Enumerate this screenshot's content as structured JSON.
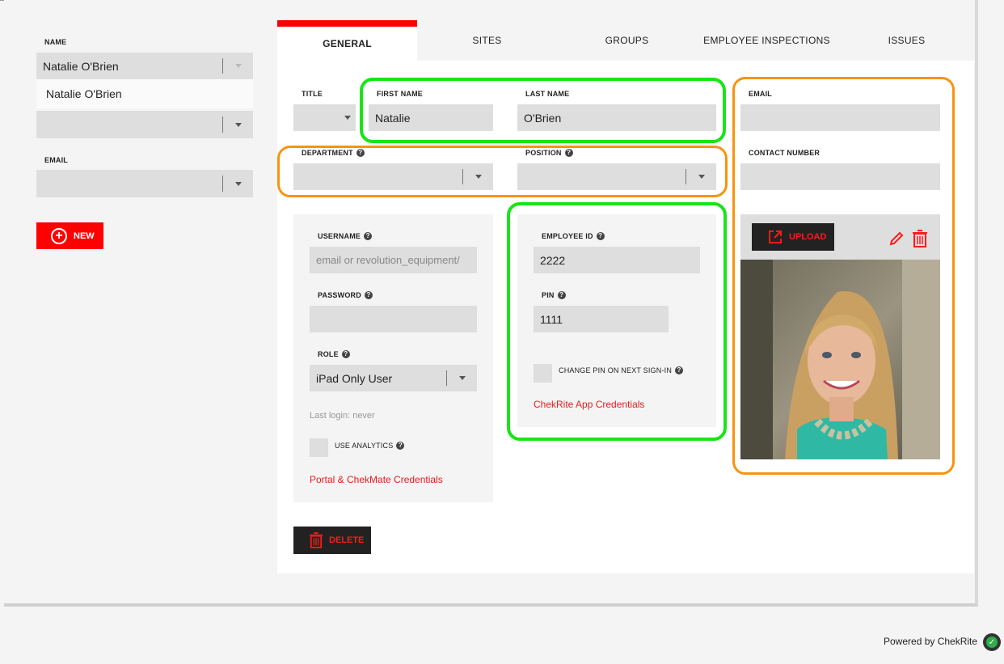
{
  "sidebar": {
    "name_label": "NAME",
    "name_value": "Natalie O'Brien",
    "name_option": "Natalie O'Brien",
    "second_select_value": "",
    "email_label": "EMAIL",
    "email_value": "",
    "new_button": "NEW"
  },
  "tabs": [
    "GENERAL",
    "SITES",
    "GROUPS",
    "EMPLOYEE INSPECTIONS",
    "ISSUES"
  ],
  "form": {
    "title_label": "TITLE",
    "title_value": "",
    "first_name_label": "FIRST NAME",
    "first_name_value": "Natalie",
    "last_name_label": "LAST NAME",
    "last_name_value": "O'Brien",
    "department_label": "DEPARTMENT",
    "department_value": "",
    "position_label": "POSITION",
    "position_value": "",
    "email_label": "EMAIL",
    "email_value": "",
    "contact_label": "CONTACT NUMBER",
    "contact_value": ""
  },
  "portal": {
    "username_label": "USERNAME",
    "username_placeholder": "email or revolution_equipment/",
    "password_label": "PASSWORD",
    "password_value": "",
    "role_label": "ROLE",
    "role_value": "iPad Only User",
    "last_login": "Last login: never",
    "analytics_label": "USE ANALYTICS",
    "credentials_link": "Portal & ChekMate Credentials",
    "delete_button": "DELETE"
  },
  "app": {
    "employee_id_label": "EMPLOYEE ID",
    "employee_id_value": "2222",
    "pin_label": "PIN",
    "pin_value": "1111",
    "change_pin_label": "CHANGE PIN ON NEXT SIGN-IN",
    "credentials_link": "ChekRite App Credentials"
  },
  "photo": {
    "upload_button": "UPLOAD"
  },
  "footer": {
    "powered_by": "Powered by ChekRite"
  },
  "colors": {
    "accent": "#ff0000",
    "highlight_green": "#18e418",
    "highlight_orange": "#f7940e"
  }
}
